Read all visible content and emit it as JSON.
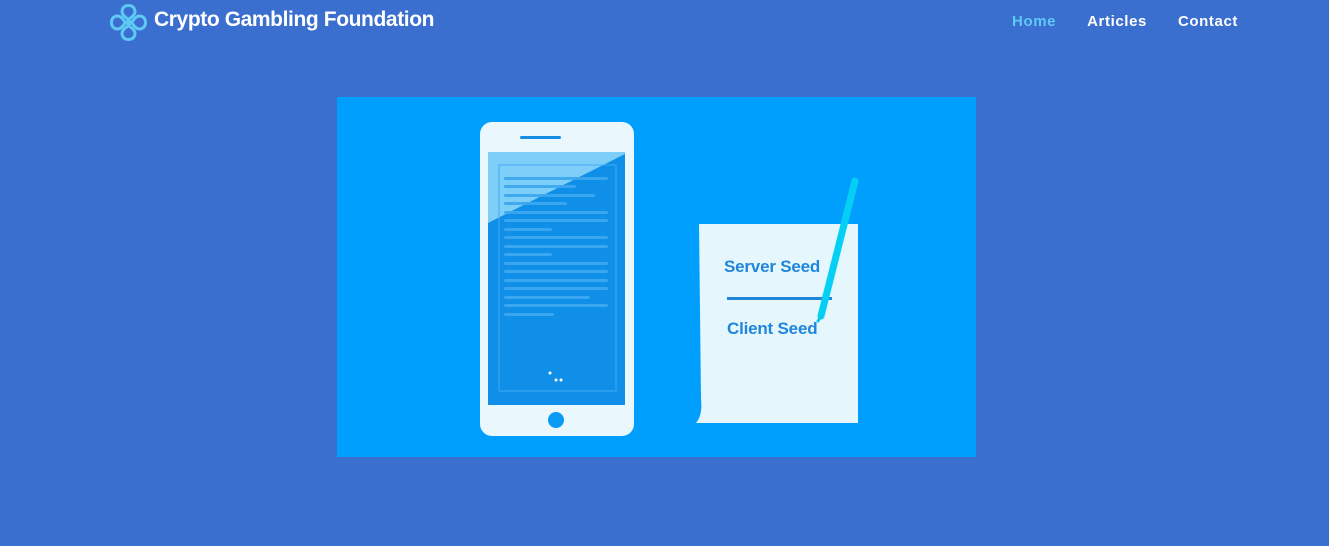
{
  "site": {
    "name": "Crypto Gambling Foundation",
    "logo_icon": "clover-link-logo-icon"
  },
  "nav": {
    "items": [
      {
        "label": "Home",
        "active": true
      },
      {
        "label": "Articles",
        "active": false
      },
      {
        "label": "Contact",
        "active": false
      }
    ]
  },
  "hero": {
    "illustration": "phone-and-seed-document",
    "server_seed_label": "Server Seed",
    "client_seed_label": "Client Seed"
  },
  "colors": {
    "page_background": "#3a6ecf",
    "hero_background": "#019ffd",
    "active_nav": "#5ec9f5",
    "nav_text": "#ffffff",
    "seed_text": "#1f86dc",
    "pen": "#05cff5"
  }
}
